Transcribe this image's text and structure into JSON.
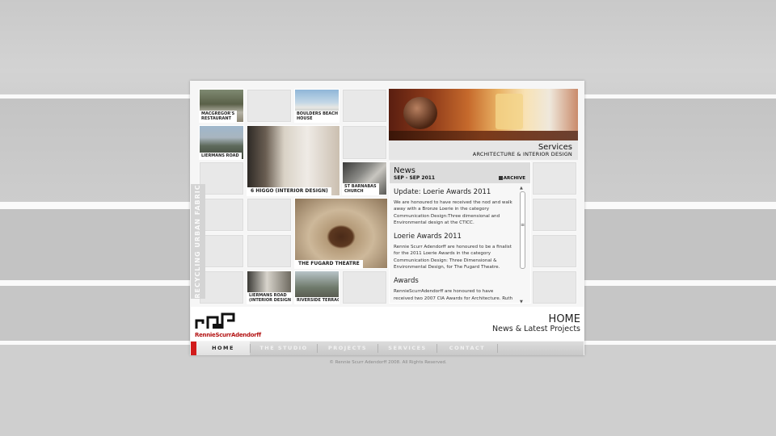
{
  "side_tab": {
    "label": "RECYCLING URBAN FABRIC"
  },
  "gallery": {
    "macgregor": "MACGREGOR'S\nRESTAURANT",
    "boulders": "BOULDERS BEACH\nHOUSE",
    "liermans_road": "LIERMANS ROAD",
    "higgo": "6 HIGGO (INTERIOR DESIGN)",
    "st_barnabas": "ST BARNABAS\nCHURCH",
    "fugard": "THE FUGARD THEATRE",
    "liermans_interior": "LIERMANS ROAD\n(INTERIOR DESIGN)",
    "riverside": "RIVERSIDE TERRACE"
  },
  "services": {
    "title": "Services",
    "subtitle": "ARCHITECTURE  & INTERIOR DESIGN"
  },
  "news": {
    "title": "News",
    "range": "SEP - SEP 2011",
    "archive": "ARCHIVE",
    "items": [
      {
        "heading": "Update: Loerie Awards 2011",
        "body": "We are honoured to have received the nod and walk away with a Bronze Loerie in the category Communication Design:Three dimensional and Environmental design at the CTICC."
      },
      {
        "heading": "Loerie Awards 2011",
        "body": "Rennie Scurr Adendorff are honoured to be a finalist for the 2011 Loerie Awards in the category Communication Design: Three Dimensional & Environmental Design, for The Fugard Theatre."
      },
      {
        "heading": "Awards",
        "body": "RennieScurrAdendorff are honoured to have received two 2007 CIA Awards for Architecture. Ruth Prowse Art Centre and The Baths, Citrusdal"
      }
    ]
  },
  "brand": {
    "logo_text": "RennieScurrAdendorff"
  },
  "page": {
    "title": "HOME",
    "subtitle": "News & Latest Projects"
  },
  "nav": {
    "items": [
      "HOME",
      "THE STUDIO",
      "PROJECTS",
      "SERVICES",
      "CONTACT"
    ]
  },
  "footer": {
    "copyright": "© Rennie Scurr Adendorff 2008. All Rights Reserved."
  },
  "colors": {
    "accent": "#d11a1a",
    "logo": "#b41414"
  }
}
